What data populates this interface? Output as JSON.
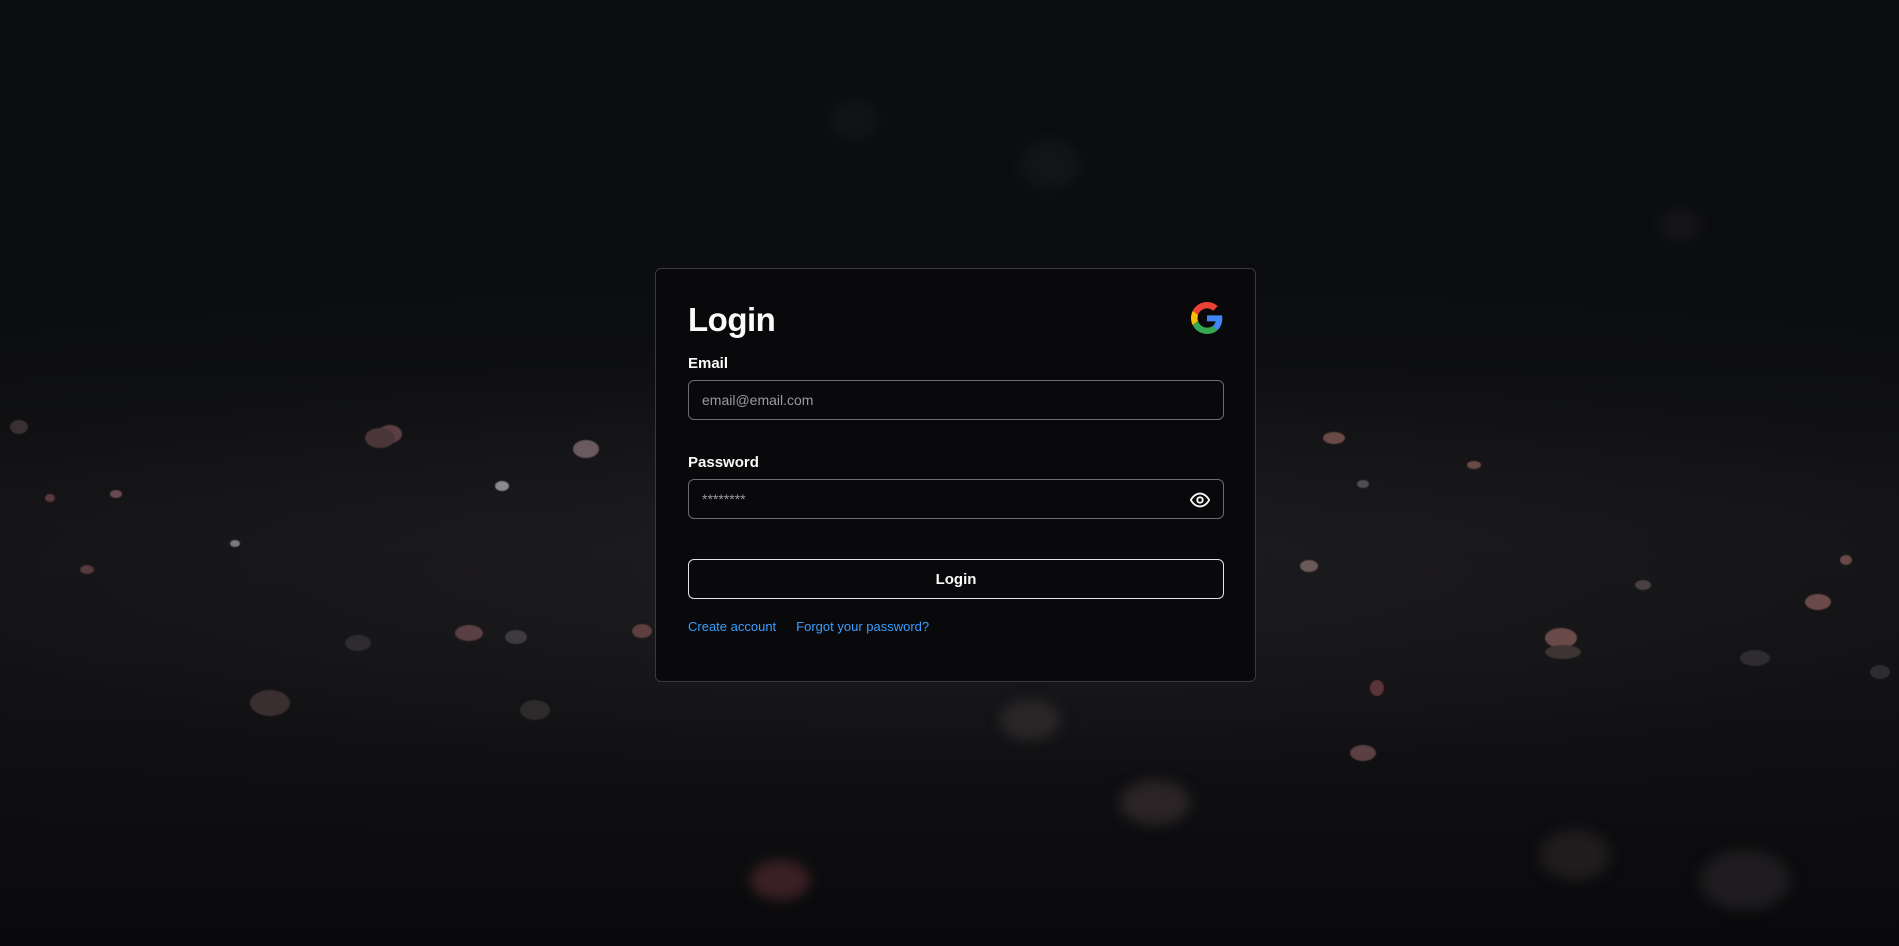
{
  "login": {
    "title": "Login",
    "email_label": "Email",
    "email_placeholder": "email@email.com",
    "email_value": "",
    "password_label": "Password",
    "password_placeholder": "********",
    "password_value": "",
    "submit_label": "Login",
    "create_account_link": "Create account",
    "forgot_password_link": "Forgot your password?"
  },
  "icons": {
    "google": "google-logo-icon",
    "show_password": "eye-icon"
  },
  "colors": {
    "background": "#0b0c0e",
    "card_background": "#09090b",
    "card_border": "#3a3a3e",
    "text": "#fafafa",
    "placeholder": "#9a9aa0",
    "link": "#3b9eff",
    "button_border": "#e4e4e7"
  }
}
